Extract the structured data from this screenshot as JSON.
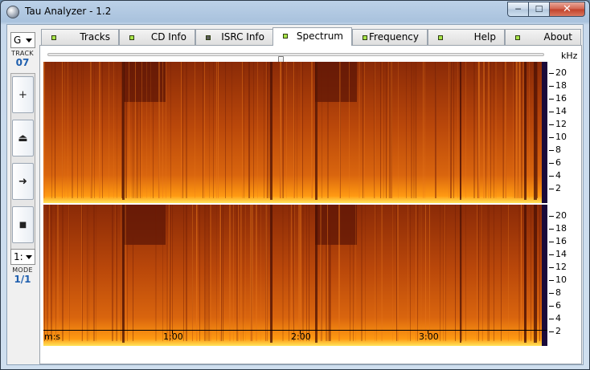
{
  "window": {
    "title": "Tau Analyzer - 1.2",
    "controls": {
      "minimize": "─",
      "maximize": "☐",
      "close": "✕"
    }
  },
  "sidebar": {
    "drive_select": "G",
    "track_label": "TRACK",
    "track_value": "07",
    "buttons": [
      {
        "name": "add-button",
        "glyph": "+"
      },
      {
        "name": "eject-button",
        "glyph": "⏏"
      },
      {
        "name": "play-button",
        "glyph": "➜"
      },
      {
        "name": "stop-button",
        "glyph": "■"
      }
    ],
    "mode_select": "1:",
    "mode_label": "MODE",
    "mode_value": "1/1"
  },
  "tabs": [
    {
      "label": "Tracks",
      "led": "#a9e64a",
      "active": false
    },
    {
      "label": "CD Info",
      "led": "#a9e64a",
      "active": false
    },
    {
      "label": "ISRC Info",
      "led": "#5c5c5c",
      "active": false
    },
    {
      "label": "Spectrum",
      "led": "#a9e64a",
      "active": true
    },
    {
      "label": "Frequency",
      "led": "#a9e64a",
      "active": false
    },
    {
      "label": "Help",
      "led": "#a9e64a",
      "active": false
    },
    {
      "label": "About",
      "led": "#a9e64a",
      "active": false
    }
  ],
  "spectrum": {
    "unit": "kHz",
    "freq_ticks": [
      "20",
      "18",
      "16",
      "14",
      "12",
      "10",
      "8",
      "6",
      "4",
      "2"
    ],
    "time_unit": "m:s",
    "time_ticks": [
      "1:00",
      "2:00",
      "3:00"
    ],
    "position_fraction": 0.47,
    "channels": [
      "left",
      "right"
    ],
    "colors": {
      "base": "#b34508",
      "dark": "#5a1406",
      "bright": "#ff9a12",
      "floor": "#ffe35a",
      "edge": "#1a0a3a"
    }
  }
}
